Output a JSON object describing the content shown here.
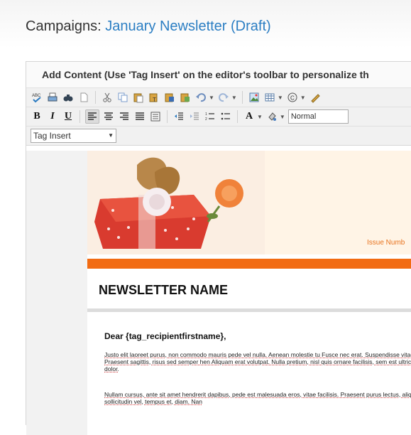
{
  "page": {
    "title_prefix": "Campaigns:",
    "campaign_name": "January Newsletter (Draft)"
  },
  "panel": {
    "header": "Add Content (Use 'Tag Insert' on the editor's toolbar to personalize th"
  },
  "toolbar": {
    "style_value": "Normal",
    "bold": "B",
    "italic": "I",
    "underline": "U",
    "font_color": "A"
  },
  "tag_insert": {
    "label": "Tag Insert"
  },
  "newsletter": {
    "issue_text": "Issue Numb",
    "title": "NEWSLETTER NAME",
    "greeting": "Dear {tag_recipientfirstname},",
    "paragraph1": "Justo elit laoreet purus, non commodo mauris pede vel nulla. Aenean molestie tu Fusce nec erat. Suspendisse vitae nibh. Praesent sagittis, risus sed semper hen Aliquam erat volutpat. Nulla pretium, nisl quis ornare facilisis, sem est ultricies m dolor.",
    "paragraph2": "Nullam cursus, ante sit amet hendrerit dapibus, pede est malesuada eros, vitae facilisis. Praesent purus lectus, aliquet nec, sollicitudin vel, tempus et, diam. Nan"
  },
  "colors": {
    "link": "#2b7ec3",
    "accent_orange": "#f26b12",
    "issue_orange": "#e8731e"
  }
}
